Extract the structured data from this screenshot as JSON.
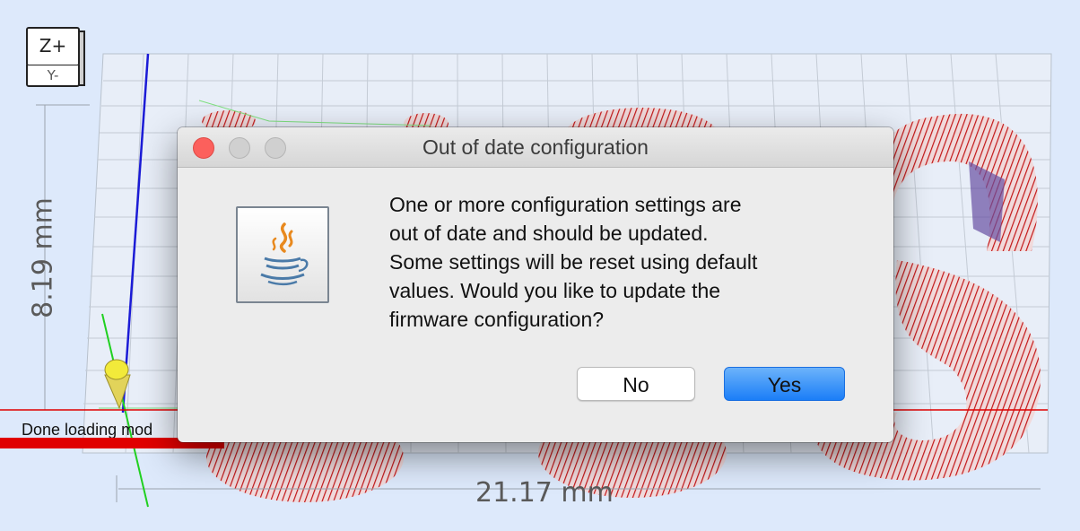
{
  "viewport": {
    "view_cube": {
      "top_label": "Z+",
      "front_label": "Y-"
    },
    "dimension_height": "8.19 mm",
    "dimension_width": "21.17 mm",
    "status_text": "Done loading mod"
  },
  "dialog": {
    "title": "Out of date configuration",
    "message_lines": [
      "One or more configuration settings are",
      "out of date and should be updated.",
      "Some settings will be reset using default",
      "values. Would you like to update the",
      "firmware configuration?"
    ],
    "buttons": {
      "no_label": "No",
      "yes_label": "Yes"
    },
    "icon": "java-coffee-cup-icon"
  },
  "colors": {
    "viewport_bg": "#dde9fb",
    "model_red": "#b40000",
    "primary_button": "#1b7ef7",
    "close_button": "#fc605c"
  }
}
